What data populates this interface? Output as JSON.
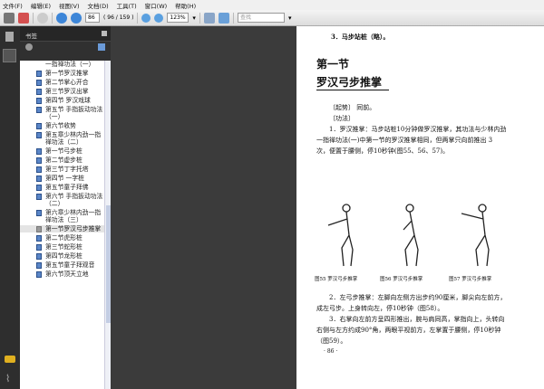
{
  "menu": [
    "文件(F)",
    "编辑(E)",
    "视图(V)",
    "文档(D)",
    "工具(T)",
    "窗口(W)",
    "帮助(H)"
  ],
  "toolbar": {
    "page": "86",
    "page_count": "( 96 / 159 )",
    "zoom": "123%",
    "search_placeholder": "查找"
  },
  "panel": {
    "title": "书签"
  },
  "bookmarks": [
    {
      "label": "一指禅功法（一）",
      "cont": true
    },
    {
      "label": "第一节罗汉推掌"
    },
    {
      "label": "第二节掌心开合"
    },
    {
      "label": "第三节罗汉出掌"
    },
    {
      "label": "第四节 罗汉戏球"
    },
    {
      "label": "第五节 手指扳动功法（一）"
    },
    {
      "label": "第六节收势"
    },
    {
      "label": "第五章少林内劲一指禅功法（二）"
    },
    {
      "label": "第一节弓步桩"
    },
    {
      "label": "第二节虚步桩"
    },
    {
      "label": "第三节丁字托塔"
    },
    {
      "label": "第四节 一字桩"
    },
    {
      "label": "第五节童子拜佛"
    },
    {
      "label": "第六节 手指扳动功法（二）"
    },
    {
      "label": "第六章少林内劲一指禅功法（三）"
    },
    {
      "label": "第一节罗汉弓步推掌",
      "selected": true
    },
    {
      "label": "第二节虎形桩"
    },
    {
      "label": "第三节蛇形桩"
    },
    {
      "label": "第四节龙形桩"
    },
    {
      "label": "第五节童子拜观音"
    },
    {
      "label": "第六节顶天立地"
    }
  ],
  "page": {
    "line1": "3．马步站桩（略）。",
    "section": "第一节",
    "heading": "罗汉弓步推掌",
    "qishi": "〔起势〕 同前。",
    "gongfa": "〔功法〕",
    "para1": "1．罗汉推掌：马步站桩10分钟做罗汉推掌，其功法与少林内劲一指禅功法(一)中第一节的罗汉推掌相同，但两掌只向前推出 3 次，便置于腰侧，停10秒钟(图55、56、57)。",
    "captions": [
      "图55  罗汉弓步推掌",
      "图56  罗汉弓步推掌",
      "图57  罗汉弓步推掌"
    ],
    "para2": "2．左弓步推掌：左脚向左侧方出步约90厘米，脚尖向左前方，成左弓步。上身转向左，停10秒钟（图58）。",
    "para3": "3．右掌向左前方呈四形推出，腕与肩同高，掌指向上，头转向右侧与左方约成90°角，两眼平视前方，左掌置于腰侧，停10秒钟（图59）。",
    "page_number": "· 86 ·"
  }
}
